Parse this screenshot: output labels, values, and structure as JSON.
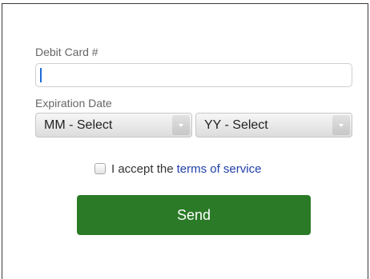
{
  "form": {
    "card_label": "Debit Card #",
    "card_value": "",
    "expiration_label": "Expiration Date",
    "month_select": {
      "selected": "MM - Select",
      "icon": "chevron-down-icon"
    },
    "year_select": {
      "selected": "YY - Select",
      "icon": "chevron-down-icon"
    },
    "terms": {
      "checked": false,
      "text": "I accept the",
      "link_text": "terms of service"
    },
    "send_label": "Send"
  },
  "colors": {
    "send_button": "#2a7a27",
    "link": "#1f3fa8",
    "caret": "#1e6bd6"
  }
}
